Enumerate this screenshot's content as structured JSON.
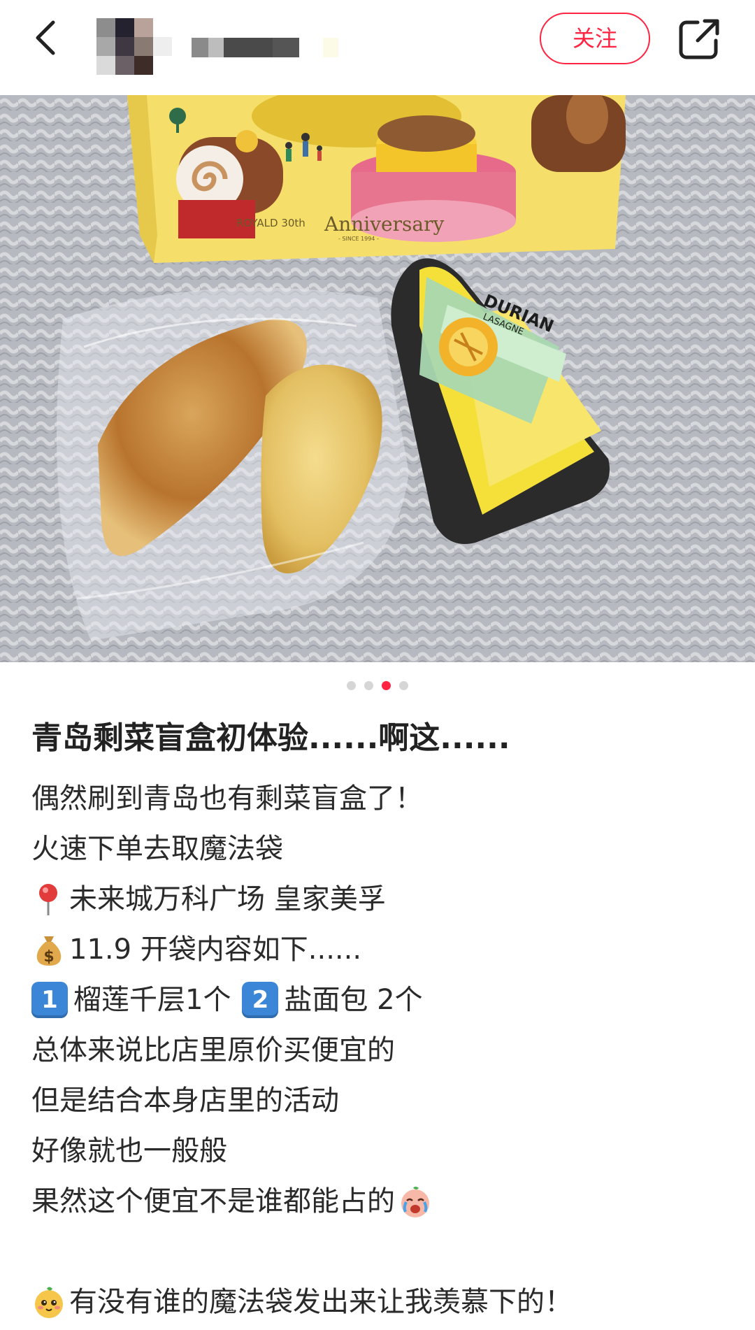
{
  "topbar": {
    "follow_label": "关注"
  },
  "carousel": {
    "total": 4,
    "active_index": 2
  },
  "photo_text": {
    "bag_brand": "ROYALD 30th",
    "bag_anniversary": "Anniversary",
    "bag_since": "- SINCE 1994 -",
    "label_line1": "DURIAN",
    "label_line2": "LASAGNE"
  },
  "post": {
    "title": "青岛剩菜盲盒初体验......啊这......",
    "lines": [
      "偶然刷到青岛也有剩菜盲盒了！",
      "火速下单去取魔法袋",
      "未来城万科广场 皇家美孚",
      "11.9 开袋内容如下......",
      "榴莲千层1个",
      "盐面包 2个",
      "总体来说比店里原价买便宜的",
      "但是结合本身店里的活动",
      "好像就也一般般",
      "果然这个便宜不是谁都能占的",
      "",
      "有没有谁的魔法袋发出来让我羡慕下的！"
    ],
    "num_keys": [
      "1",
      "2"
    ]
  },
  "icons": {
    "pin": "round-pushpin-icon",
    "money": "money-bag-icon",
    "cry": "crying-face-icon",
    "face": "cute-face-icon"
  },
  "colors": {
    "accent": "#ff2442",
    "num_key": "#3b86d6"
  }
}
